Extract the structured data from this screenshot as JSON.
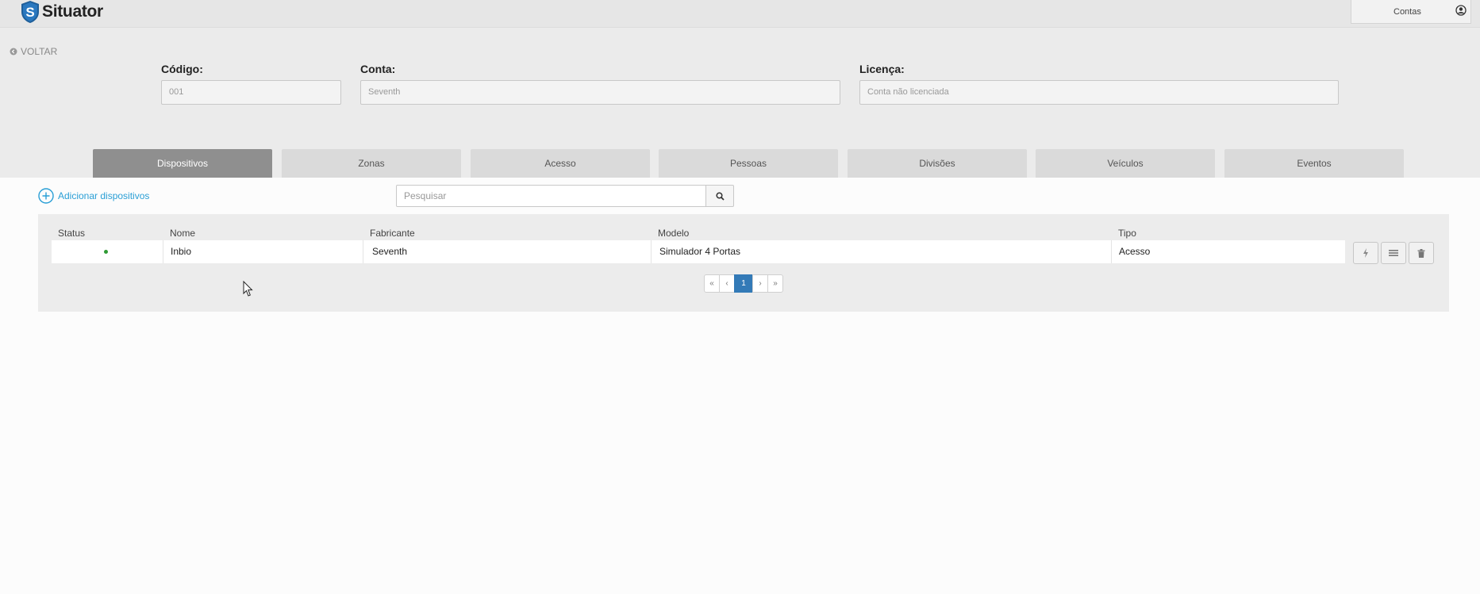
{
  "app": {
    "brand": "Situator",
    "logo_letter": "S"
  },
  "user_menu": {
    "label": "Contas",
    "icon": "user-circle-icon"
  },
  "back": {
    "label": "VOLTAR",
    "icon": "arrow-circle-left-icon"
  },
  "account": {
    "code_label": "Código:",
    "code_value": "001",
    "name_label": "Conta:",
    "name_value": "Seventh",
    "license_label": "Licença:",
    "license_value": "Conta não licenciada"
  },
  "tabs": [
    {
      "label": "Dispositivos",
      "active": true
    },
    {
      "label": "Zonas",
      "active": false
    },
    {
      "label": "Acesso",
      "active": false
    },
    {
      "label": "Pessoas",
      "active": false
    },
    {
      "label": "Divisões",
      "active": false
    },
    {
      "label": "Veículos",
      "active": false
    },
    {
      "label": "Eventos",
      "active": false
    }
  ],
  "toolbar": {
    "add_label": "Adicionar dispositivos",
    "add_icon": "plus-circle-icon",
    "search_placeholder": "Pesquisar",
    "search_icon": "search-icon"
  },
  "table": {
    "columns": [
      "Status",
      "Nome",
      "Fabricante",
      "Modelo",
      "Tipo"
    ],
    "rows": [
      {
        "status": "online",
        "name": "Inbio",
        "manufacturer": "Seventh",
        "model": "Simulador 4 Portas",
        "type": "Acesso"
      }
    ],
    "row_actions": [
      "bolt-icon",
      "list-icon",
      "trash-icon"
    ]
  },
  "pagination": {
    "first": "«",
    "prev": "‹",
    "current": "1",
    "next": "›",
    "last": "»"
  },
  "colors": {
    "accent": "#2a9fd6",
    "active_tab": "#8f8f8f",
    "status_online": "#2e9a34",
    "page_current": "#337ab7",
    "logo_blue": "#1f5f9a"
  }
}
